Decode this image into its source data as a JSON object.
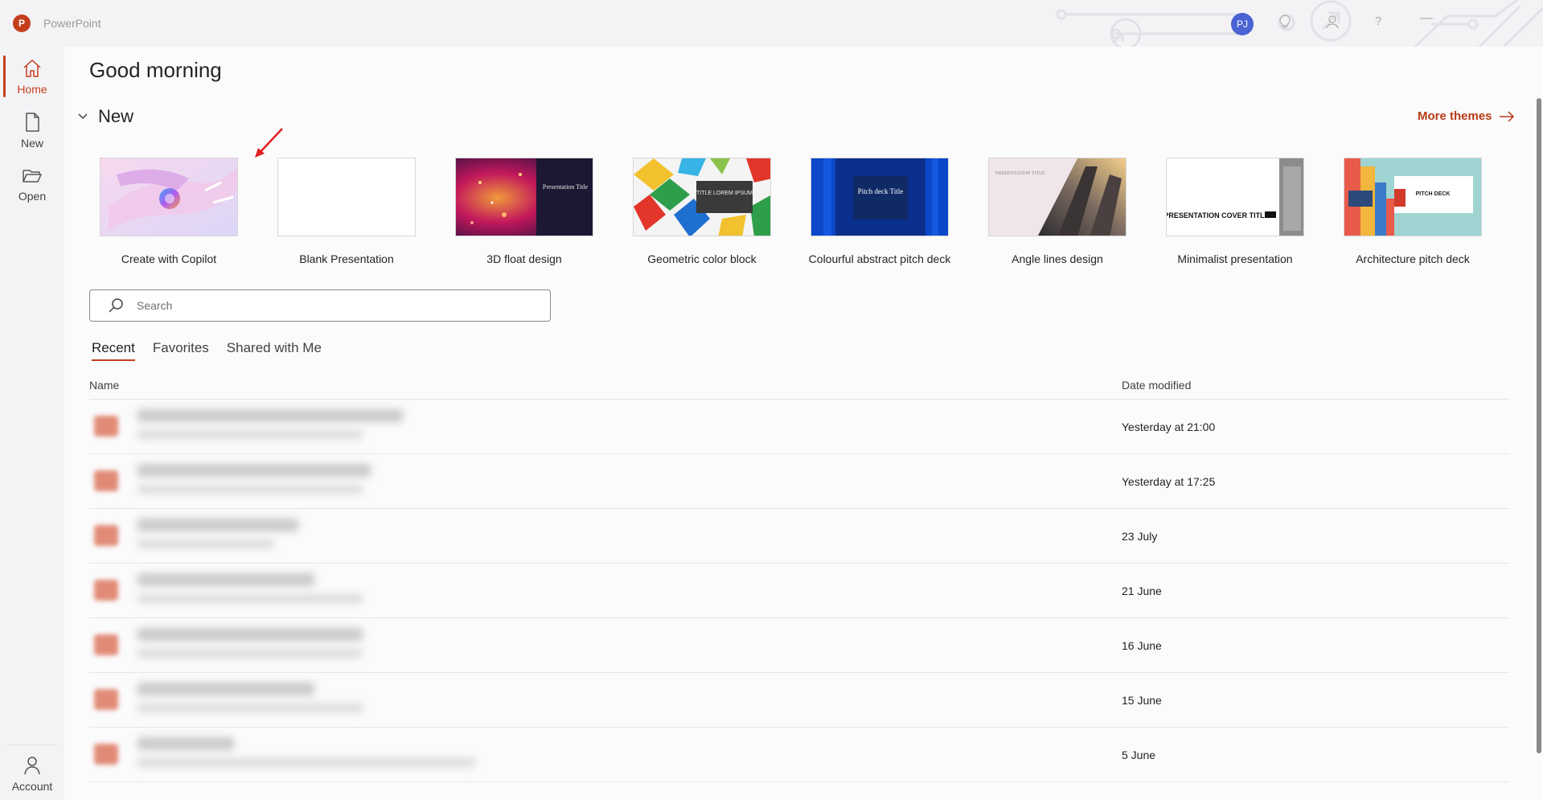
{
  "titlebar": {
    "app_name": "PowerPoint",
    "app_logo_letter": "P",
    "avatar_initials": "PJ",
    "help_glyph": "?",
    "minimize_glyph": "—"
  },
  "rail": {
    "items": [
      {
        "label": "Home",
        "icon": "home-icon",
        "active": true
      },
      {
        "label": "New",
        "icon": "new-file-icon"
      },
      {
        "label": "Open",
        "icon": "folder-open-icon"
      }
    ],
    "account_label": "Account"
  },
  "main": {
    "greeting": "Good morning",
    "new_section_title": "New",
    "more_themes_label": "More themes",
    "templates": [
      {
        "label": "Create with Copilot"
      },
      {
        "label": "Blank Presentation"
      },
      {
        "label": "3D float design",
        "thumb_text": "Presentation Title"
      },
      {
        "label": "Geometric color block",
        "thumb_text": "TITLE LOREM IPSUM"
      },
      {
        "label": "Colourful abstract pitch deck",
        "thumb_text": "Pitch deck Title"
      },
      {
        "label": "Angle lines design",
        "thumb_text": "PRESENTATION TITLE"
      },
      {
        "label": "Minimalist presentation",
        "thumb_text": "PRESENTATION COVER TITLE"
      },
      {
        "label": "Architecture pitch deck",
        "thumb_text": "PITCH DECK"
      }
    ],
    "search": {
      "placeholder": "Search"
    },
    "file_tabs": [
      {
        "label": "Recent",
        "active": true
      },
      {
        "label": "Favorites"
      },
      {
        "label": "Shared with Me"
      }
    ],
    "columns": {
      "name": "Name",
      "date_modified": "Date modified"
    },
    "files": [
      {
        "date": "Yesterday at 21:00"
      },
      {
        "date": "Yesterday at 17:25"
      },
      {
        "date": "23 July"
      },
      {
        "date": "21 June"
      },
      {
        "date": "16 June"
      },
      {
        "date": "15 June"
      },
      {
        "date": "5 June"
      }
    ]
  },
  "colors": {
    "accent": "#c43e1c",
    "link": "#b83a16",
    "avatar": "#4a63d3"
  }
}
